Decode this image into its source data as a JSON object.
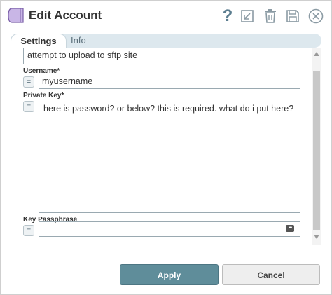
{
  "dialog": {
    "title": "Edit Account"
  },
  "toolbar": {
    "help_glyph": "?",
    "icons": [
      "help-icon",
      "export-icon",
      "trash-icon",
      "save-icon",
      "close-icon"
    ]
  },
  "tabs": [
    {
      "label": "Settings",
      "active": true
    },
    {
      "label": "Info",
      "active": false
    }
  ],
  "fields": {
    "label_value": "attempt to upload to sftp site",
    "username": {
      "label": "Username*",
      "value": "myusername"
    },
    "private_key": {
      "label": "Private Key*",
      "value": "here is password? or below? this is required. what do i put here?"
    },
    "key_passphrase": {
      "label": "Key Passphrase",
      "value": ""
    }
  },
  "expression_button_glyph": "=",
  "password_icon_glyph": "•••",
  "buttons": {
    "apply": "Apply",
    "cancel": "Cancel"
  },
  "colors": {
    "accent": "#5f8d9a",
    "tab_bar": "#dde8ee",
    "logo": "#c9b6e6"
  }
}
